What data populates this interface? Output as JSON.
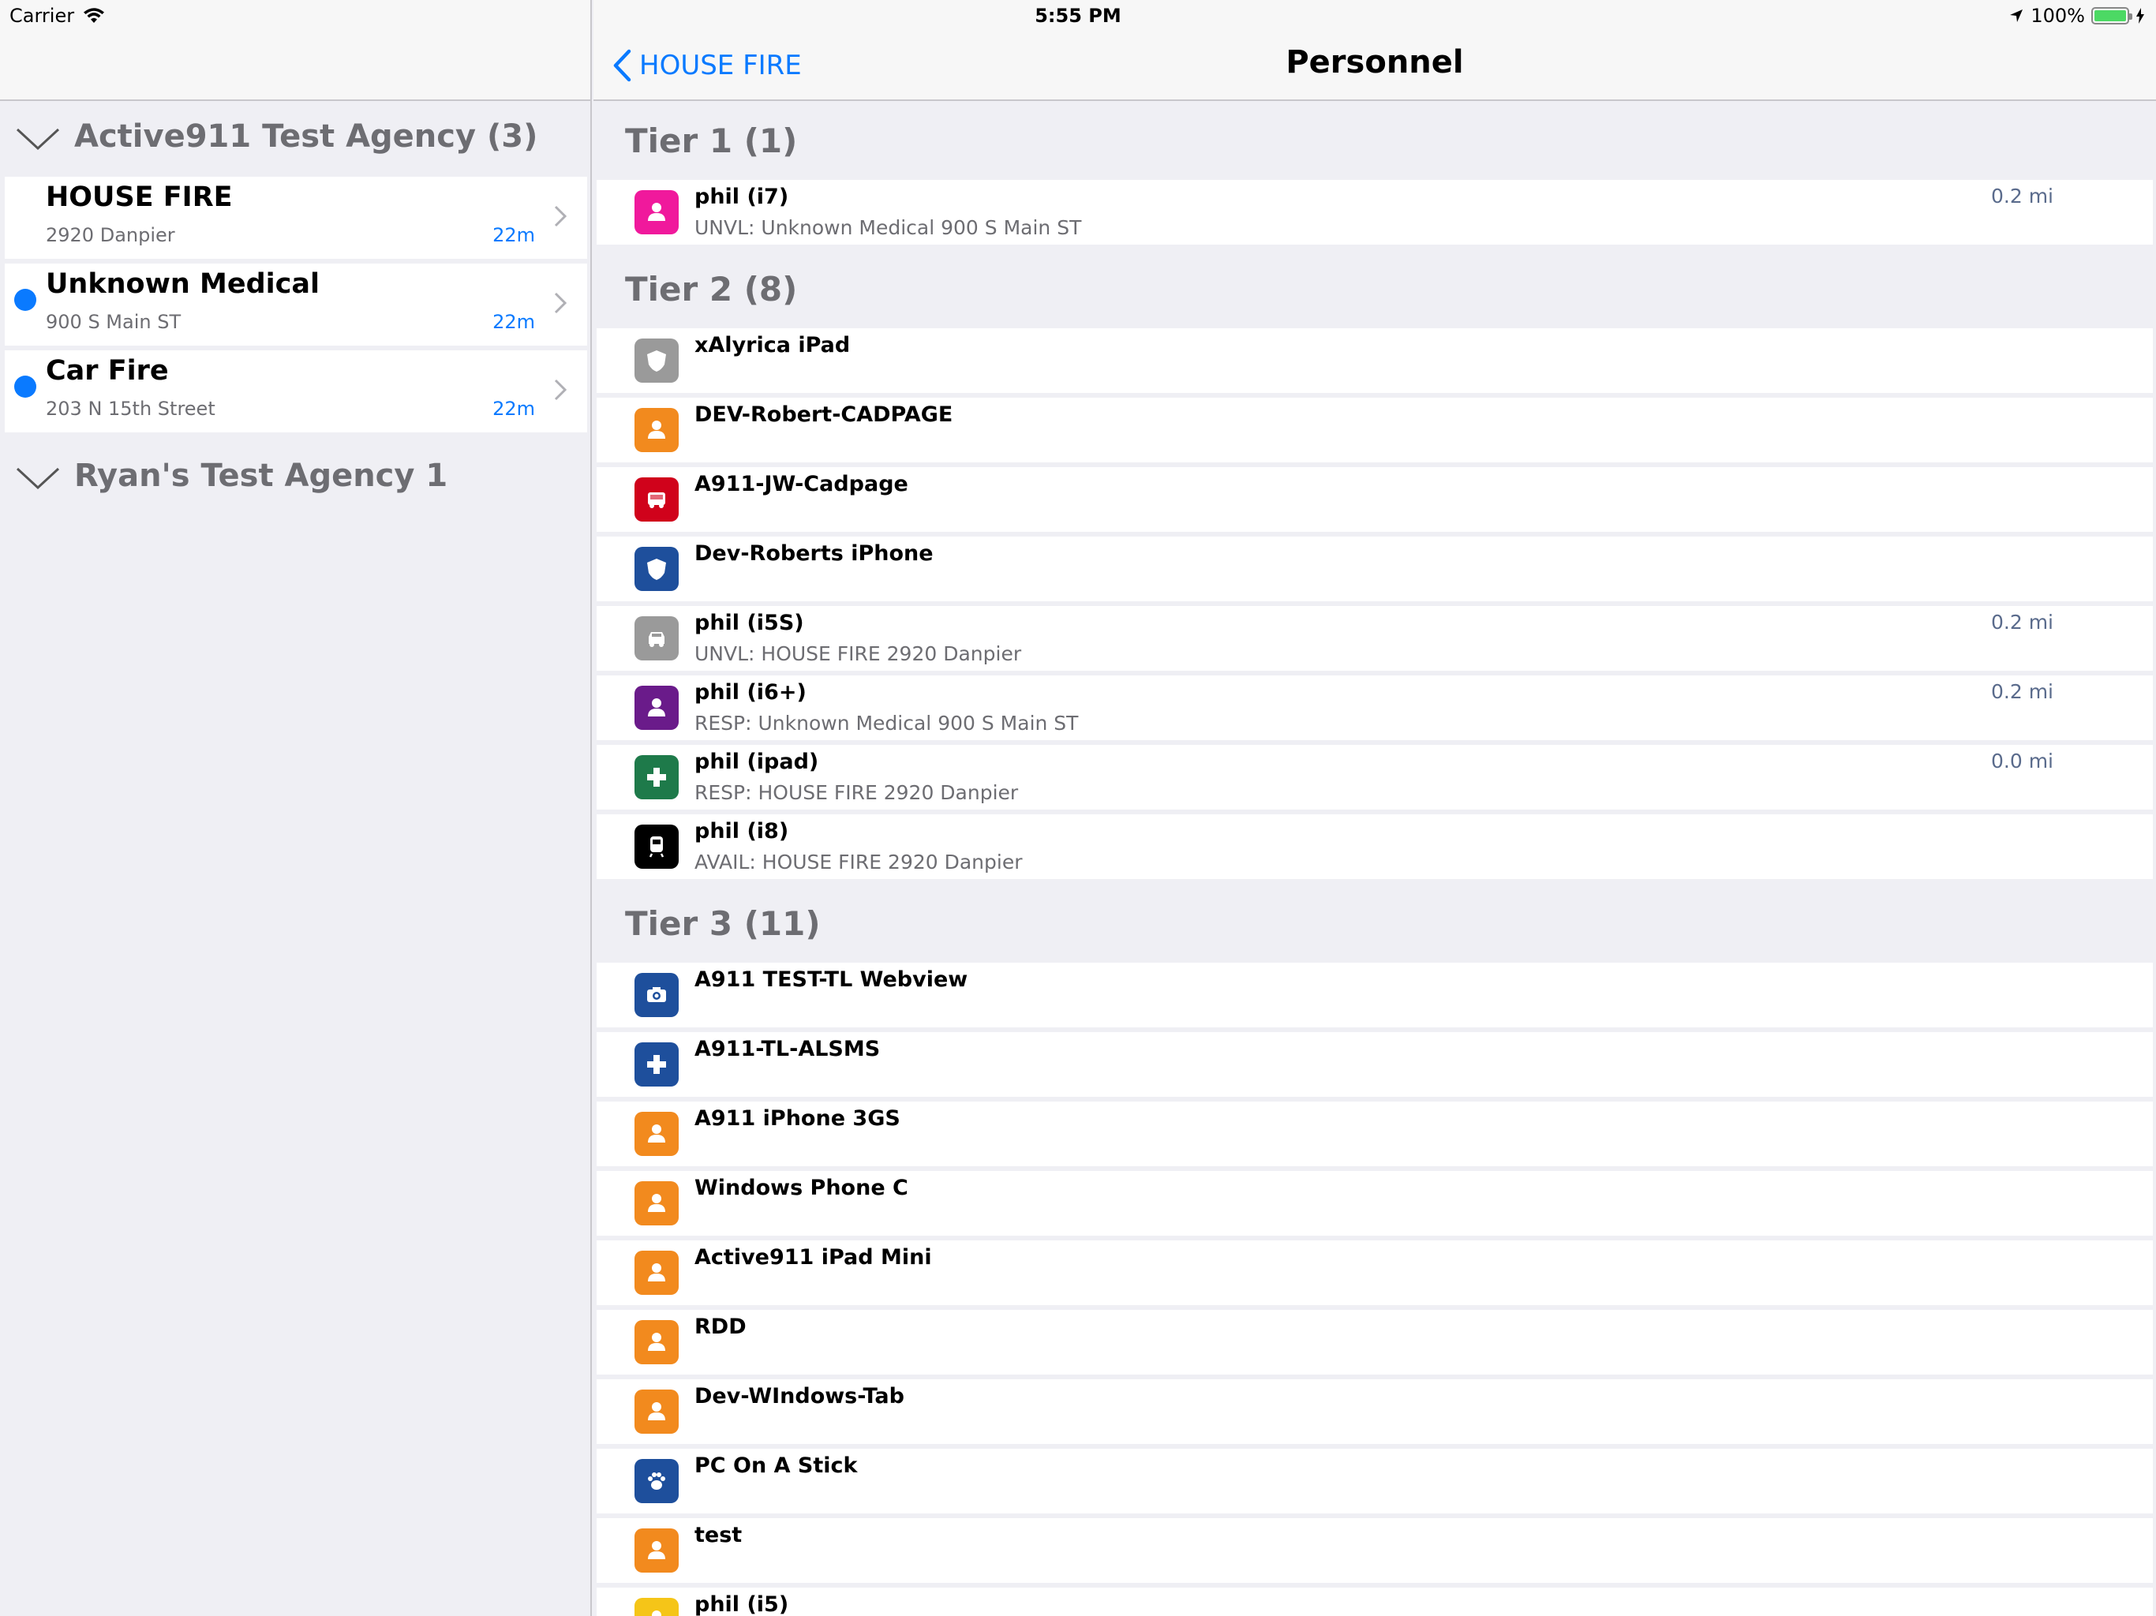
{
  "status_bar": {
    "carrier": "Carrier",
    "time": "5:55 PM",
    "battery": "100%"
  },
  "colors": {
    "accent": "#0a7aff",
    "battery": "#4cd964"
  },
  "master": {
    "agencies": [
      {
        "title": "Active911 Test Agency (3)",
        "incidents": [
          {
            "name": "HOUSE FIRE",
            "address": "2920 Danpier",
            "age": "22m",
            "unread": false
          },
          {
            "name": "Unknown Medical",
            "address": "900 S Main ST",
            "age": "22m",
            "unread": true
          },
          {
            "name": "Car Fire",
            "address": "203 N 15th Street",
            "age": "22m",
            "unread": true
          }
        ]
      },
      {
        "title": "Ryan's Test Agency 1"
      }
    ]
  },
  "detail": {
    "back_label": "HOUSE FIRE",
    "title": "Personnel",
    "tiers": [
      {
        "label": "Tier 1 (1)",
        "members": [
          {
            "name": "phil (i7)",
            "status": "UNVL: Unknown Medical 900 S Main ST",
            "distance": "0.2 mi",
            "icon": "person-icon",
            "color": "#f0199c"
          }
        ]
      },
      {
        "label": "Tier 2 (8)",
        "members": [
          {
            "name": "xAlyrica iPad",
            "status": "",
            "distance": "",
            "icon": "police-badge-icon",
            "color": "#9a9a9a"
          },
          {
            "name": "DEV-Robert-CADPAGE",
            "status": "",
            "distance": "",
            "icon": "person-icon",
            "color": "#f28a1e"
          },
          {
            "name": "A911-JW-Cadpage",
            "status": "",
            "distance": "",
            "icon": "fire-truck-icon",
            "color": "#d0021b"
          },
          {
            "name": "Dev-Roberts iPhone",
            "status": "",
            "distance": "",
            "icon": "police-badge-icon",
            "color": "#1e4f9c"
          },
          {
            "name": "phil (i5S)",
            "status": "UNVL: HOUSE FIRE 2920 Danpier",
            "distance": "0.2 mi",
            "icon": "car-icon",
            "color": "#9a9a9a"
          },
          {
            "name": "phil (i6+)",
            "status": "RESP: Unknown Medical 900 S Main ST",
            "distance": "0.2 mi",
            "icon": "person-icon",
            "color": "#6a1b8a"
          },
          {
            "name": "phil (ipad)",
            "status": "RESP: HOUSE FIRE 2920 Danpier",
            "distance": "0.0 mi",
            "icon": "medical-cross-icon",
            "color": "#1e7a4a"
          },
          {
            "name": "phil (i8)",
            "status": "AVAIL: HOUSE FIRE 2920 Danpier",
            "distance": "",
            "icon": "train-icon",
            "color": "#000000"
          }
        ]
      },
      {
        "label": "Tier 3 (11)",
        "members": [
          {
            "name": " A911 TEST-TL Webview",
            "status": "",
            "distance": "",
            "icon": "camera-icon",
            "color": "#1e4f9c"
          },
          {
            "name": " A911-TL-ALSMS",
            "status": "",
            "distance": "",
            "icon": "medical-cross-icon",
            "color": "#1e4f9c"
          },
          {
            "name": "A911 iPhone 3GS",
            "status": "",
            "distance": "",
            "icon": "person-icon",
            "color": "#f28a1e"
          },
          {
            "name": "Windows Phone C",
            "status": "",
            "distance": "",
            "icon": "person-icon",
            "color": "#f28a1e"
          },
          {
            "name": "Active911 iPad Mini",
            "status": "",
            "distance": "",
            "icon": "person-icon",
            "color": "#f28a1e"
          },
          {
            "name": "RDD",
            "status": "",
            "distance": "",
            "icon": "person-icon",
            "color": "#f28a1e"
          },
          {
            "name": "Dev-WIndows-Tab",
            "status": "",
            "distance": "",
            "icon": "person-icon",
            "color": "#f28a1e"
          },
          {
            "name": "PC On A Stick",
            "status": "",
            "distance": "",
            "icon": "paw-icon",
            "color": "#1e4f9c"
          },
          {
            "name": "test",
            "status": "",
            "distance": "",
            "icon": "person-icon",
            "color": "#f28a1e"
          },
          {
            "name": "phil (i5)",
            "status": "",
            "distance": "",
            "icon": "person-icon",
            "color": "#f5c518"
          }
        ]
      }
    ]
  }
}
